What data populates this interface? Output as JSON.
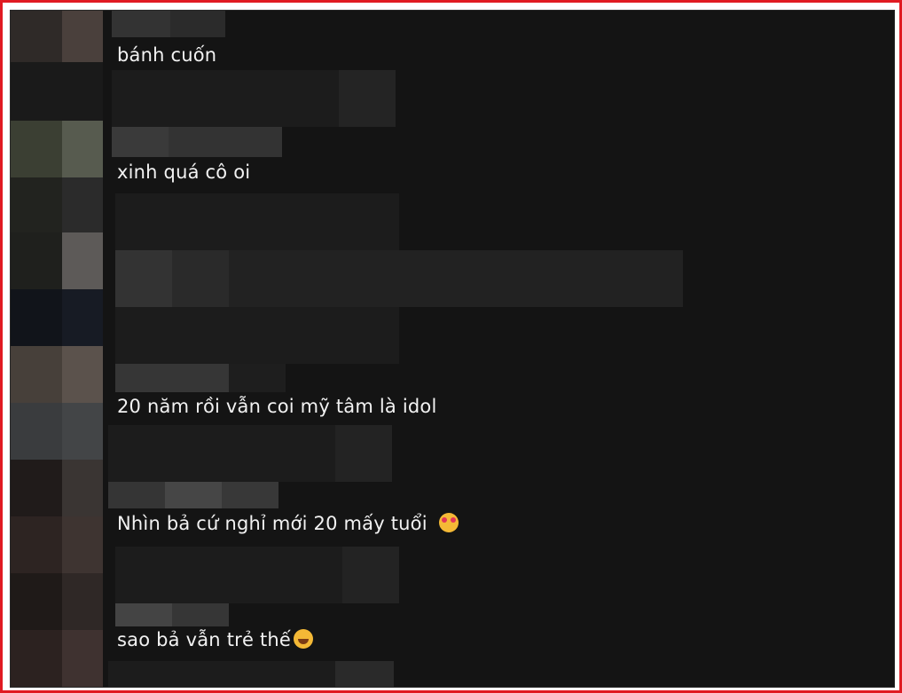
{
  "comments": [
    {
      "text": "bánh cuốn",
      "emoji": ""
    },
    {
      "text": "xinh quá cô oi",
      "emoji": ""
    },
    {
      "text": "20 năm rồi vẫn coi mỹ tâm là idol",
      "emoji": ""
    },
    {
      "text": "Nhìn bả cứ nghỉ mới 20 mấy tuổi",
      "emoji": "smiling-face-with-hearts-icon"
    },
    {
      "text": "sao bả vẫn trẻ thế",
      "emoji": "grinning-sweat-face-icon"
    }
  ],
  "colors": {
    "frame_border": "#e01b22",
    "background": "#141414",
    "text": "#f2f2f2"
  }
}
